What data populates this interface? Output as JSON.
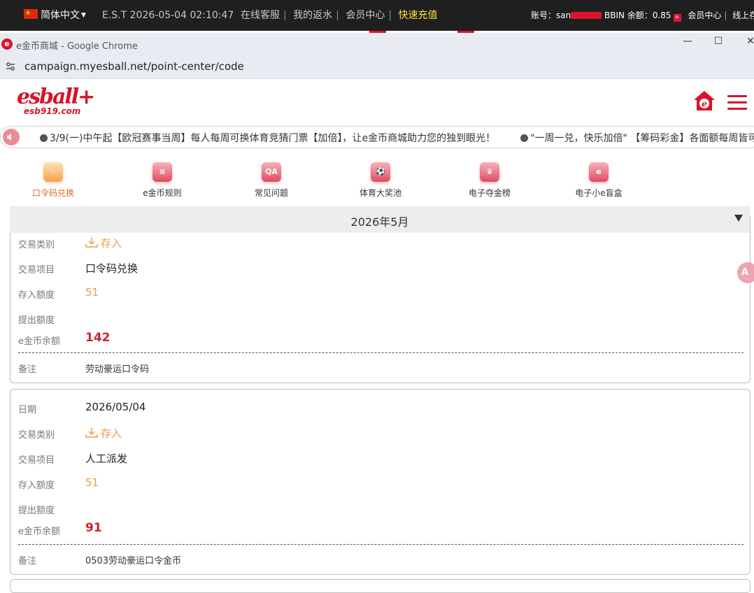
{
  "topbar": {
    "flag_symbol": "★",
    "language": "简体中文",
    "clock": "E.S.T 2026-05-04 02:10:47",
    "links": [
      "在线客服",
      "我的返水",
      "会员中心"
    ],
    "recharge": "快速充值",
    "account_label": "账号：san",
    "platform_balance": "BBIN 余额：0.85",
    "member_center": "会员中心",
    "right_link": "线上存款"
  },
  "window": {
    "title": "e金币商城 - Google Chrome",
    "url": "campaign.myesball.net/point-center/code",
    "controls": [
      "—",
      "☐",
      "✕"
    ]
  },
  "header": {
    "logo_main": "esball+",
    "logo_sub": "esb919.com",
    "brand_color": "#d8132a"
  },
  "marquee": {
    "items": [
      "3/9(一)中午起【欧冠赛事当周】每人每周可换体育竞猜门票【加倍】，让e金币商城助力您的独到眼光！",
      "\"一周一兑，快乐加倍\" 【筹码彩金】各面额每周皆可兑"
    ]
  },
  "nav": {
    "items": [
      {
        "label": "口令码兑换",
        "glyph": "☆"
      },
      {
        "label": "e金币规则",
        "glyph": "≡"
      },
      {
        "label": "常见问题",
        "glyph": "QA"
      },
      {
        "label": "体育大奖池",
        "glyph": "⚽"
      },
      {
        "label": "电子夺金榜",
        "glyph": "♛"
      },
      {
        "label": "电子小e盲盒",
        "glyph": "e"
      }
    ]
  },
  "month": "2026年5月",
  "records": [
    {
      "type_label": "交易类别",
      "type_value": "存入",
      "item_label": "交易项目",
      "item_value": "口令码兑换",
      "deposit_label": "存入额度",
      "deposit_value": "51",
      "withdraw_label": "提出额度",
      "withdraw_value": "",
      "balance_label": "e金币余额",
      "balance_value": "142",
      "note_label": "备注",
      "note_value": "劳动豪运口令码"
    },
    {
      "date_label": "日期",
      "date_value": "2026/05/04",
      "type_label": "交易类别",
      "type_value": "存入",
      "item_label": "交易项目",
      "item_value": "人工派发",
      "deposit_label": "存入额度",
      "deposit_value": "51",
      "withdraw_label": "提出额度",
      "withdraw_value": "",
      "balance_label": "e金币余额",
      "balance_value": "91",
      "note_label": "备注",
      "note_value": "0503劳动豪运口令金币"
    }
  ],
  "float_button": "A"
}
